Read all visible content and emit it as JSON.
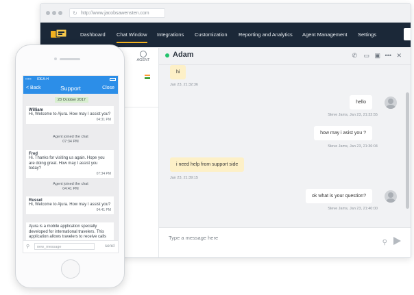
{
  "browser": {
    "url": "http://www.jacobsawensten.com",
    "nav": [
      "Dashboard",
      "Chat Window",
      "Integrations",
      "Customization",
      "Reporting and Analytics",
      "Agent Management",
      "Settings"
    ],
    "active_nav": "Chat Window",
    "left_tab_label": "AGENT",
    "chat": {
      "name": "Adam",
      "compose_placeholder": "Type a message here",
      "messages": [
        {
          "dir": "in",
          "text": "hi",
          "meta": "Jan 23, 21:32:36"
        },
        {
          "dir": "out",
          "text": "hello",
          "meta": "Steve Jams, Jan 23, 21:32:55"
        },
        {
          "dir": "out",
          "text": "how may i asist you ?",
          "meta": "Steve Jams, Jan 23, 21:36:04"
        },
        {
          "dir": "in",
          "text": "i need help from support side",
          "meta": "Jan 23, 21:39:15"
        },
        {
          "dir": "out",
          "text": "ok what is your question?",
          "meta": "Steve Jams, Jan 23, 21:40:00"
        }
      ]
    }
  },
  "phone": {
    "carrier": "IDEA-H",
    "back": "< Back",
    "title": "Support",
    "close": "Close",
    "date": "23 October 2017",
    "items": [
      {
        "type": "msg",
        "who": "William",
        "text": "Hi, Welcome to Ajura. How may I assist you?",
        "time": "04:31 PM"
      },
      {
        "type": "sys",
        "text": "Agent joined the chat",
        "time": "07:34 PM"
      },
      {
        "type": "msg",
        "who": "Fred",
        "text": "Hi. Thanks for visiting us again. Hope you are doing great. How may I assist you today?",
        "time": "07:34 PM"
      },
      {
        "type": "sys",
        "text": "Agent joined the chat",
        "time": "04:41 PM"
      },
      {
        "type": "msg",
        "who": "Russel",
        "text": "Hi, Welcome to Ajura. How may I assist you?",
        "time": "04:41 PM"
      },
      {
        "type": "msg",
        "who": "",
        "text": "Ajura is a mobile application specially developed for international travelers. This application allows travelers to receive calls on",
        "time": ""
      }
    ],
    "input_placeholder": "new_message",
    "send": "send"
  }
}
